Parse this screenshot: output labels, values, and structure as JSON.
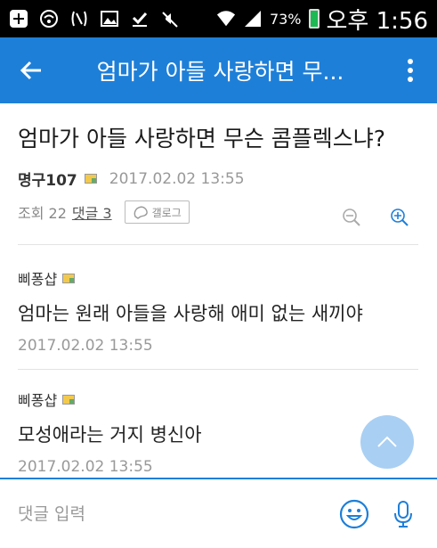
{
  "status_bar": {
    "battery": "73%",
    "time": "오후 1:56"
  },
  "app_bar": {
    "title": "엄마가 아들 사랑하면 무..."
  },
  "post": {
    "title": "엄마가 아들 사랑하면 무슨 콤플렉스냐?",
    "author": "명구107",
    "date": "2017.02.02 13:55",
    "views_label": "조회 22",
    "comments_label": "댓글 3",
    "gallog_label": "갤로그"
  },
  "comments": [
    {
      "nick": "삐퐁샵",
      "body": "엄마는 원래 아들을 사랑해 애미 없는 새끼야",
      "date": "2017.02.02 13:55"
    },
    {
      "nick": "삐퐁샵",
      "body": "모성애라는 거지 병신아",
      "date": "2017.02.02 13:55"
    }
  ],
  "input": {
    "placeholder": "댓글 입력"
  },
  "colors": {
    "primary": "#1e7fd8",
    "fab": "#a9cff3"
  }
}
